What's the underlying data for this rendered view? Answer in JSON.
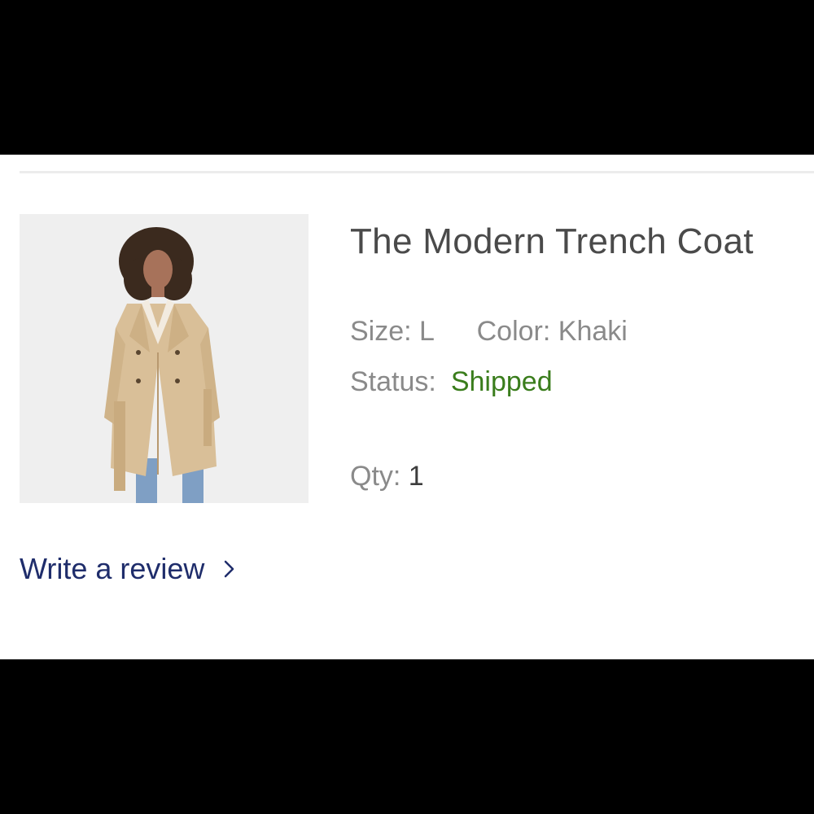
{
  "product": {
    "title": "The Modern Trench Coat",
    "image_alt": "Model wearing khaki trench coat"
  },
  "details": {
    "size_label": "Size:",
    "size_value": "L",
    "color_label": "Color:",
    "color_value": "Khaki",
    "status_label": "Status:",
    "status_value": "Shipped",
    "qty_label": "Qty:",
    "qty_value": "1"
  },
  "actions": {
    "review_label": "Write a review",
    "review_icon": "chevron-right-icon"
  },
  "colors": {
    "status_shipped": "#3a7d1c",
    "link": "#1f2d6b",
    "coat": "#d9bf98"
  }
}
